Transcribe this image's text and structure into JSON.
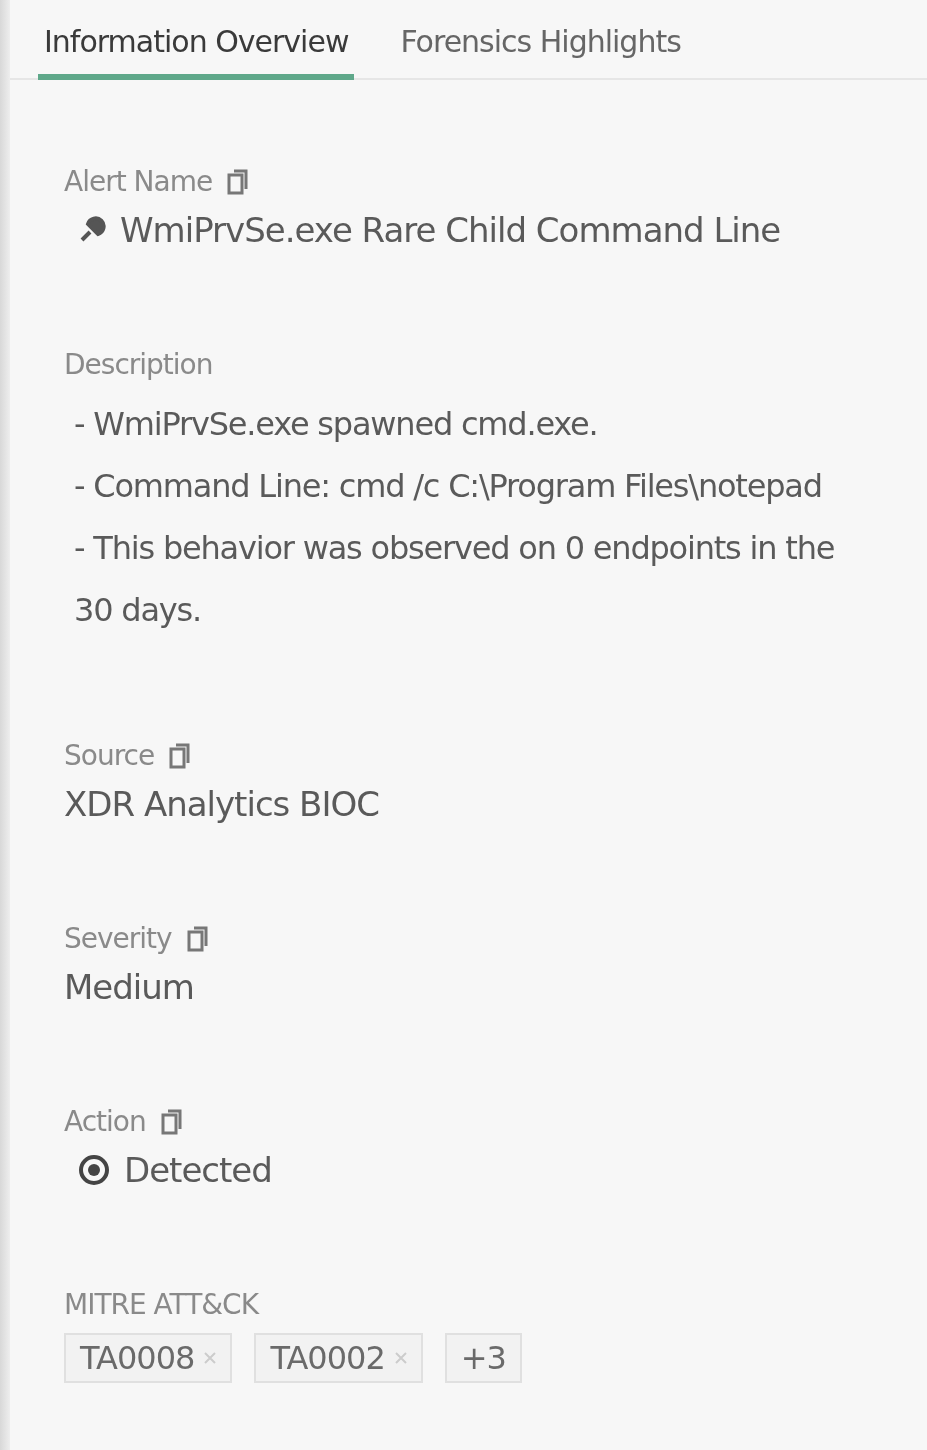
{
  "tabs": [
    {
      "label": "Information Overview",
      "selected": true
    },
    {
      "label": "Forensics Highlights",
      "selected": false
    }
  ],
  "fields": [
    {
      "kind": "name",
      "label": "Alert Name",
      "copyable": true,
      "value": "WmiPrvSe.exe Rare Child Command Line"
    },
    {
      "kind": "lines",
      "label": "Description",
      "copyable": false,
      "lines": [
        "- WmiPrvSe.exe spawned cmd.exe.",
        "- Command Line: cmd /c C:\\Program Files\\notepad",
        "- This behavior was observed on 0 endpoints in the",
        "30 days."
      ]
    },
    {
      "kind": "text",
      "label": "Source",
      "copyable": true,
      "value": "XDR Analytics BIOC"
    },
    {
      "kind": "text",
      "label": "Severity",
      "copyable": true,
      "value": "Medium"
    },
    {
      "kind": "status",
      "label": "Action",
      "copyable": true,
      "value": "Detected"
    },
    {
      "kind": "tags",
      "label": "MITRE ATT&CK",
      "copyable": false,
      "tags": [
        {
          "text": "TA0008",
          "removable": true
        },
        {
          "text": "TA0002",
          "removable": true
        },
        {
          "text": "+3",
          "removable": false
        }
      ]
    }
  ]
}
